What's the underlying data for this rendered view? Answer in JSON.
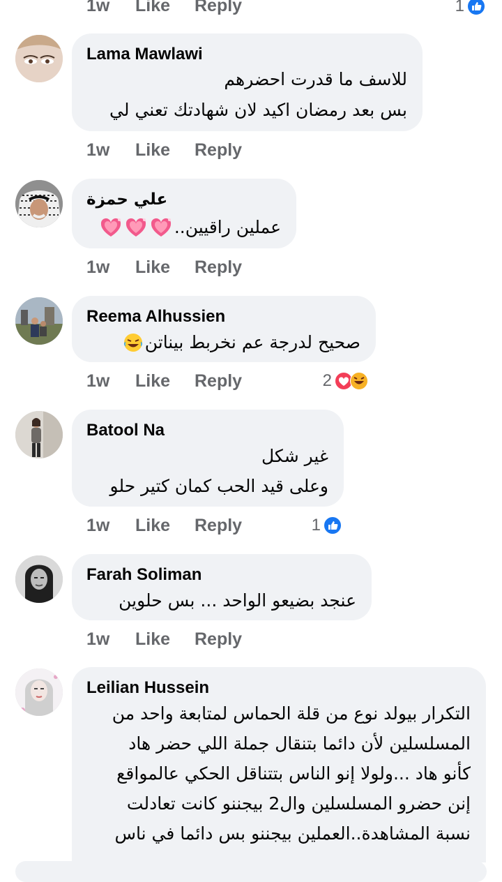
{
  "top_actions": {
    "time": "1w",
    "like": "Like",
    "reply": "Reply",
    "reaction_count": "1"
  },
  "comments": [
    {
      "author": "Lama Mawlawi",
      "lines": [
        "للاسف ما قدرت احضرهم",
        "بس بعد رمضان اكيد لان شهادتك تعني لي"
      ],
      "time": "1w",
      "like": "Like",
      "reply": "Reply",
      "avatar": "woman-eyes-photo"
    },
    {
      "author": "علي حمزة",
      "lines": [
        "عملين راقيين.."
      ],
      "time": "1w",
      "like": "Like",
      "reply": "Reply",
      "avatar": "man-keffiyeh-photo",
      "emoji": [
        "sparkling-heart",
        "sparkling-heart",
        "sparkling-heart"
      ]
    },
    {
      "author": "Reema Alhussien",
      "lines": [
        "صحيح لدرجة عم نخربط بيناتن"
      ],
      "time": "1w",
      "like": "Like",
      "reply": "Reply",
      "avatar": "outdoor-people-photo",
      "emoji": [
        "rolling-laughing"
      ],
      "reaction_count": "2",
      "reactions": [
        "love",
        "haha"
      ]
    },
    {
      "author": "Batool Na",
      "lines": [
        "غير شكل",
        "وعلى قيد الحب كمان كتير حلو"
      ],
      "time": "1w",
      "like": "Like",
      "reply": "Reply",
      "avatar": "woman-standing-photo",
      "reaction_count": "1",
      "reactions": [
        "like"
      ]
    },
    {
      "author": "Farah Soliman",
      "lines": [
        "عنجد بضيعو الواحد ... بس حلوين"
      ],
      "time": "1w",
      "like": "Like",
      "reply": "Reply",
      "avatar": "woman-bw-photo"
    },
    {
      "author": "Leilian Hussein",
      "lines": [
        "التكرار بيولد نوع من قلة الحماس لمتابعة واحد من",
        "المسلسلين لأن دائما بتنقال جملة اللي حضر هاد",
        "كأنو هاد ...ولولا إنو الناس بتتناقل الحكي عالمواقع",
        "إنن حضرو المسلسلين وال2 بيجننو كانت تعادلت",
        "نسبة المشاهدة..العملين بيجننو بس دائما في ناس"
      ],
      "avatar": "woman-sketch-photo"
    }
  ],
  "colors": {
    "bubble": "#f0f2f5",
    "meta": "#65676b",
    "like_blue": "#1877f2",
    "love_red": "#f33e58",
    "haha_yellow": "#f7b125"
  }
}
